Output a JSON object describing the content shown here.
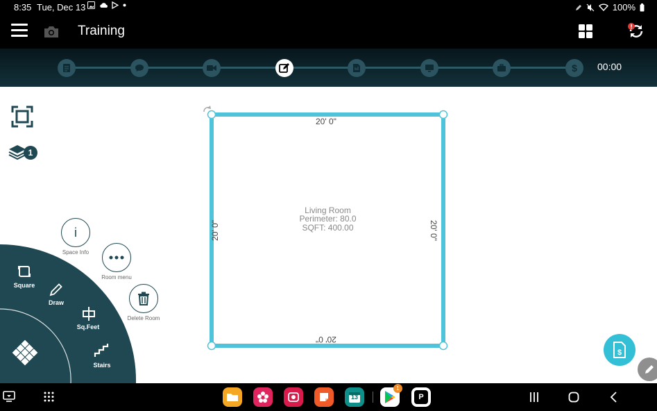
{
  "status_bar": {
    "time": "8:35",
    "date": "Tue, Dec 13",
    "battery": "100%"
  },
  "app_bar": {
    "title": "Training"
  },
  "step_bar": {
    "steps": [
      "notes-icon",
      "chat-icon",
      "video-icon",
      "edit-icon",
      "document-icon",
      "monitor-icon",
      "briefcase-icon",
      "dollar-icon"
    ],
    "active_step": 3,
    "timer": "00:00"
  },
  "layers": {
    "count": "1"
  },
  "room": {
    "name": "Living Room",
    "perimeter": "Perimeter: 80.0",
    "sqft": "SQFT: 400.00",
    "top_dim": "20' 0\"",
    "bottom_dim": "20' 0\"",
    "left_dim": "20' 0\"",
    "right_dim": "20' 0\""
  },
  "radial_menu": {
    "square": "Square",
    "draw": "Draw",
    "sqfeet": "Sq.Feet",
    "stairs": "Stairs"
  },
  "room_actions": {
    "space_info": "Space Info",
    "room_menu": "Room menu",
    "delete_room": "Delete Room"
  },
  "colors": {
    "room_wall": "#4fc3d9",
    "accent": "#33bfd6",
    "menu_bg": "#1f4852"
  },
  "taskbar": {
    "calendar_day": "13",
    "play_badge": "1",
    "p_app": "P"
  }
}
